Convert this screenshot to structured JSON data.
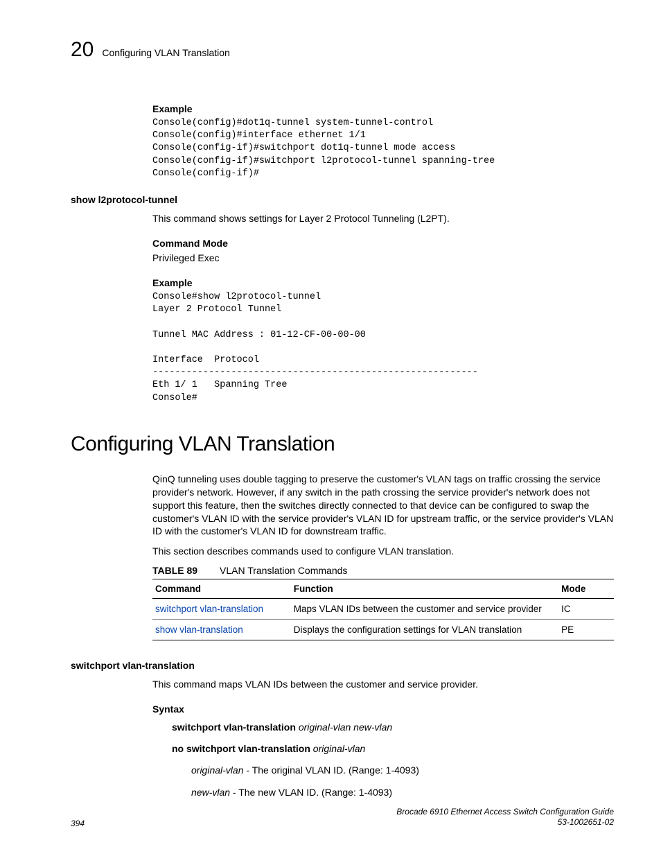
{
  "header": {
    "chapter_number": "20",
    "running_title": "Configuring VLAN Translation"
  },
  "section1": {
    "example_label": "Example",
    "example_code": "Console(config)#dot1q-tunnel system-tunnel-control\nConsole(config)#interface ethernet 1/1\nConsole(config-if)#switchport dot1q-tunnel mode access\nConsole(config-if)#switchport l2protocol-tunnel spanning-tree\nConsole(config-if)#"
  },
  "section2": {
    "side_heading": "show l2protocol-tunnel",
    "description": "This command shows settings for Layer 2 Protocol Tunneling (L2PT).",
    "command_mode_label": "Command Mode",
    "command_mode_value": "Privileged Exec",
    "example_label": "Example",
    "example_code": "Console#show l2protocol-tunnel\nLayer 2 Protocol Tunnel\n\nTunnel MAC Address : 01-12-CF-00-00-00\n\nInterface  Protocol\n----------------------------------------------------------\nEth 1/ 1   Spanning Tree\nConsole#"
  },
  "main_heading": "Configuring VLAN Translation",
  "intro_para1": "QinQ tunneling uses double tagging to preserve the customer's VLAN tags on traffic crossing the service provider's network. However, if any switch in the path crossing the service provider's network does not support this feature, then the switches directly connected to that device can be configured to swap the customer's VLAN ID with the service provider's VLAN ID for upstream traffic, or the service provider's VLAN ID with the customer's VLAN ID for downstream traffic.",
  "intro_para2": "This section describes commands used to configure VLAN translation.",
  "table": {
    "caption_label": "TABLE 89",
    "caption_text": "VLAN Translation Commands",
    "headers": {
      "c1": "Command",
      "c2": "Function",
      "c3": "Mode"
    },
    "rows": [
      {
        "c1": "switchport vlan-translation",
        "c2": "Maps VLAN IDs between the customer and service provider",
        "c3": "IC"
      },
      {
        "c1": "show vlan-translation",
        "c2": "Displays the configuration settings for VLAN translation",
        "c3": "PE"
      }
    ]
  },
  "section3": {
    "side_heading": "switchport vlan-translation",
    "description": "This command maps VLAN IDs between the customer and service provider.",
    "syntax_label": "Syntax",
    "syntax_line1_bold": "switchport vlan-translation",
    "syntax_line1_italic": "original-vlan new-vlan",
    "syntax_line2_bold": "no switchport vlan-translation",
    "syntax_line2_italic": "original-vlan",
    "param1_name": "original-vlan",
    "param1_desc": " - The original VLAN ID. (Range: 1-4093)",
    "param2_name": "new-vlan",
    "param2_desc": " - The new VLAN ID. (Range: 1-4093)"
  },
  "footer": {
    "page_number": "394",
    "doc_title": "Brocade 6910 Ethernet Access Switch Configuration Guide",
    "doc_id": "53-1002651-02"
  }
}
